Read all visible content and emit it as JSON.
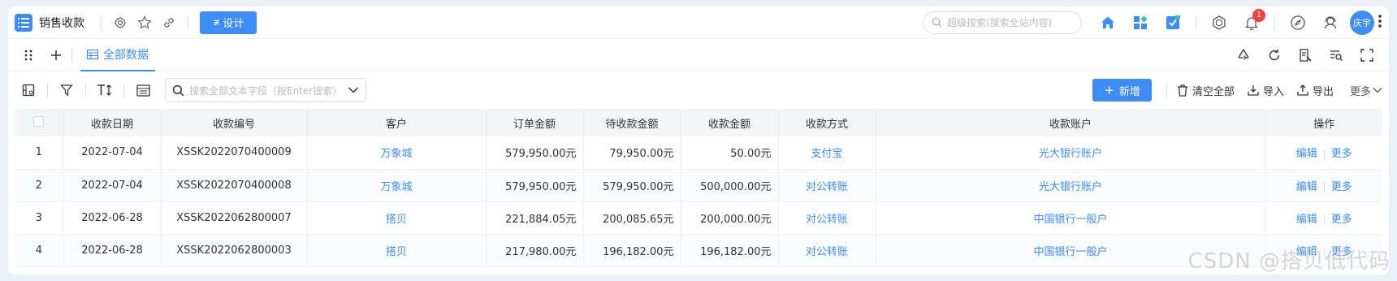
{
  "app": {
    "title": "销售收款",
    "design_label": "设计"
  },
  "global_search": {
    "placeholder": "超级搜索(搜索全站内容)"
  },
  "notifications": {
    "count": "1"
  },
  "user": {
    "avatar_text": "庆宇"
  },
  "tabs": [
    {
      "label": "全部数据"
    }
  ],
  "toolbar": {
    "search_placeholder": "搜索全部文本字段（按Enter搜索）",
    "add_label": "新增",
    "clear_all_label": "清空全部",
    "import_label": "导入",
    "export_label": "导出",
    "more_label": "更多"
  },
  "table": {
    "columns": [
      "",
      "收款日期",
      "收款编号",
      "客户",
      "订单金额",
      "待收款金额",
      "收款金额",
      "收款方式",
      "收款账户",
      "操作"
    ],
    "edit_label": "编辑",
    "more_label": "更多",
    "rows": [
      {
        "index": "1",
        "date": "2022-07-04",
        "code": "XSSK2022070400009",
        "customer": "万象城",
        "order_amount": "579,950.00元",
        "pending_amount": "79,950.00元",
        "received_amount": "50.00元",
        "method": "支付宝",
        "account": "光大银行账户"
      },
      {
        "index": "2",
        "date": "2022-07-04",
        "code": "XSSK2022070400008",
        "customer": "万象城",
        "order_amount": "579,950.00元",
        "pending_amount": "579,950.00元",
        "received_amount": "500,000.00元",
        "method": "对公转账",
        "account": "光大银行账户"
      },
      {
        "index": "3",
        "date": "2022-06-28",
        "code": "XSSK2022062800007",
        "customer": "搭贝",
        "order_amount": "221,884.05元",
        "pending_amount": "200,085.65元",
        "received_amount": "200,000.00元",
        "method": "对公转账",
        "account": "中国银行一般户"
      },
      {
        "index": "4",
        "date": "2022-06-28",
        "code": "XSSK2022062800003",
        "customer": "搭贝",
        "order_amount": "217,980.00元",
        "pending_amount": "196,182.00元",
        "received_amount": "196,182.00元",
        "method": "对公转账",
        "account": "中国银行一般户"
      }
    ]
  },
  "watermark": "CSDN @搭贝低代码",
  "colors": {
    "primary": "#3d8df5",
    "badge": "#f5413d"
  }
}
